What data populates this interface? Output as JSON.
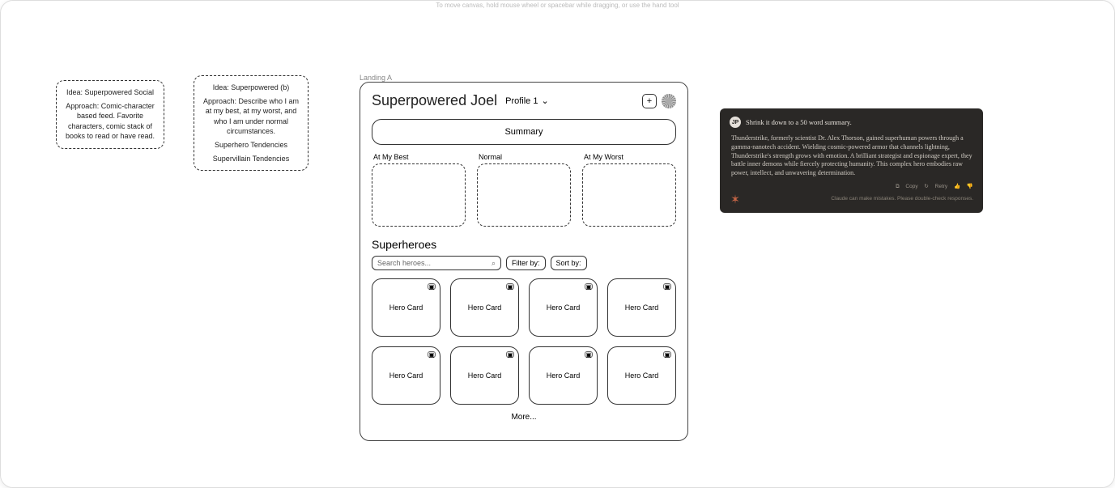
{
  "hint": "To move canvas, hold mouse wheel or spacebar while dragging, or use the hand tool",
  "sticky1": {
    "title": "Idea:  Superpowered Social",
    "body": "Approach:  Comic-character based feed. Favorite characters, comic stack of books to read or have read."
  },
  "sticky2": {
    "title": "Idea:  Superpowered (b)",
    "body": "Approach:  Describe who I am at my best, at my worst, and who I am under normal circumstances.",
    "line2": "Superhero Tendencies",
    "line3": "Supervillain Tendencies"
  },
  "frameLabel": "Landing A",
  "app": {
    "title": "Superpowered Joel",
    "profile": "Profile 1",
    "summary": "Summary",
    "states": [
      "At My Best",
      "Normal",
      "At My Worst"
    ],
    "section": "Superheroes",
    "searchPlaceholder": "Search heroes...",
    "filter": "Filter by:",
    "sort": "Sort by:",
    "heroLabel": "Hero Card",
    "more": "More..."
  },
  "chat": {
    "avatar": "JP",
    "prompt": "Shrink it down to a 50 word summary.",
    "response": "Thunderstrike, formerly scientist Dr. Alex Thorson, gained superhuman powers through a gamma-nanotech accident. Wielding cosmic-powered armor that channels lightning, Thunderstrike's strength grows with emotion. A brilliant strategist and espionage expert, they battle inner demons while fiercely protecting humanity. This complex hero embodies raw power, intellect, and unwavering determination.",
    "copy": "Copy",
    "retry": "Retry",
    "disclaimer": "Claude can make mistakes. Please double-check responses."
  }
}
